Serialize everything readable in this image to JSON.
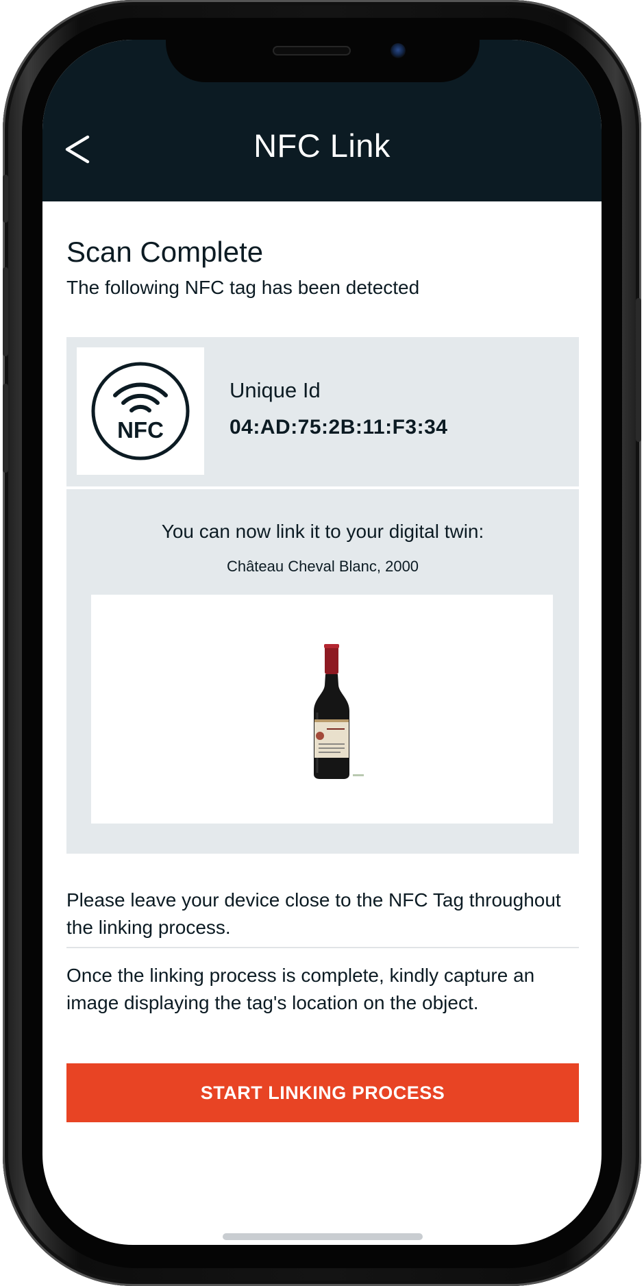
{
  "header": {
    "back_icon": "chevron-left-icon",
    "title": "NFC Link"
  },
  "scan": {
    "title": "Scan Complete",
    "subtitle": "The following NFC tag has been detected"
  },
  "tag": {
    "icon": "nfc-icon",
    "icon_text": "NFC",
    "uid_label": "Unique Id",
    "uid_value": "04:AD:75:2B:11:F3:34"
  },
  "twin": {
    "prompt": "You can now link it to your digital twin:",
    "name": "Château Cheval Blanc, 2000",
    "image_icon": "wine-bottle-image"
  },
  "notes": {
    "note_1": "Please leave your device close to the NFC Tag throughout the linking process.",
    "note_2": "Once the linking process is complete, kindly capture an image displaying the tag's location on the object."
  },
  "actions": {
    "start_label": "START LINKING PROCESS"
  },
  "colors": {
    "header_bg": "#0c1b23",
    "card_bg": "#e4e9ec",
    "accent": "#e84424",
    "text": "#0c1b23"
  }
}
